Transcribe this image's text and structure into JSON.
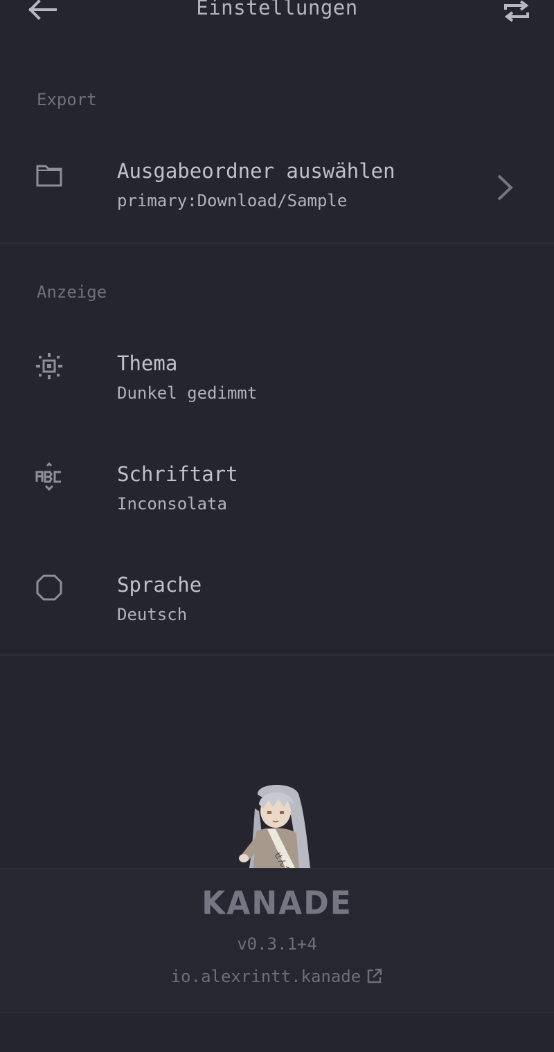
{
  "app": {
    "title": "Einstellungen",
    "icons": {
      "back": "arrow-left-icon",
      "sync": "repeat-icon"
    }
  },
  "sections": {
    "export": {
      "label": "Export",
      "items": [
        {
          "title": "Ausgabeordner auswählen",
          "subtitle": "primary:Download/Sample",
          "icon": "folder-icon"
        }
      ]
    },
    "display": {
      "label": "Anzeige",
      "items": [
        {
          "title": "Thema",
          "subtitle": "Dunkel gedimmt",
          "icon": "theme-icon"
        },
        {
          "title": "Schriftart",
          "subtitle": "Inconsolata",
          "icon": "font-icon"
        },
        {
          "title": "Sprache",
          "subtitle": "Deutsch",
          "icon": "globe-icon"
        }
      ]
    }
  },
  "footer": {
    "logo": "KANADE",
    "version": "v0.3.1+4",
    "package": "io.alexrintt.kanade"
  },
  "colors": {
    "background": "#24252e",
    "text": "#c0c1cc",
    "muted": "#6f707d"
  }
}
